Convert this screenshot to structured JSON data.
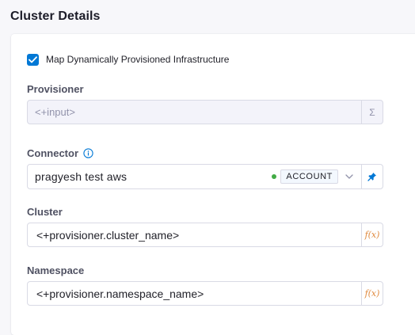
{
  "section": {
    "title": "Cluster Details"
  },
  "map_infra": {
    "label": "Map Dynamically Provisioned Infrastructure",
    "checked": true
  },
  "provisioner": {
    "label": "Provisioner",
    "value": "<+input>",
    "addon_icon": "sigma-icon",
    "addon_glyph": "Σ"
  },
  "connector": {
    "label": "Connector",
    "info_icon": "info-icon",
    "value": "pragyesh test aws",
    "status_color": "#42ab45",
    "scope": "ACCOUNT",
    "pin_icon": "pin-icon"
  },
  "cluster": {
    "label": "Cluster",
    "value": "<+provisioner.cluster_name>",
    "fx_glyph": "f(x)"
  },
  "namespace": {
    "label": "Namespace",
    "value": "<+provisioner.namespace_name>",
    "fx_glyph": "f(x)"
  },
  "colors": {
    "accent": "#0278d5",
    "fx": "#e08a3f",
    "border": "#d9dae5"
  }
}
